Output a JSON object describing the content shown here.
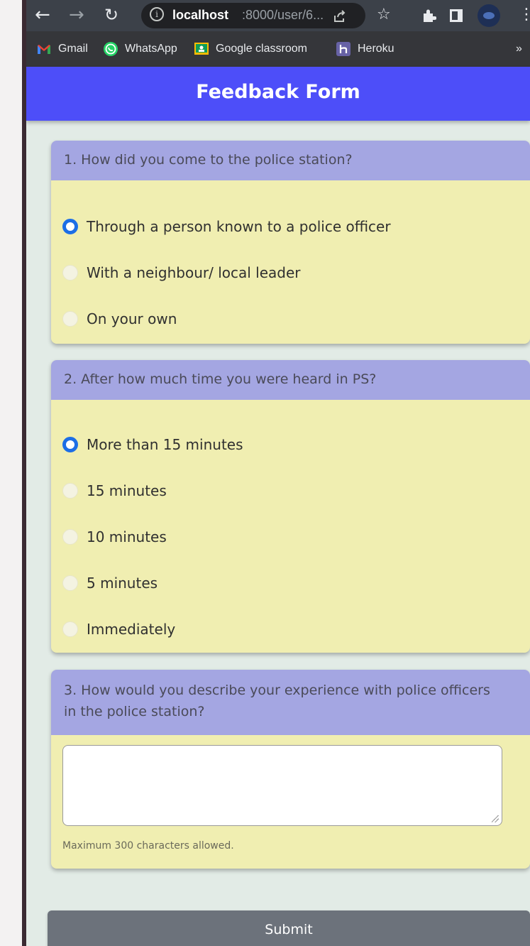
{
  "browser": {
    "url_host": "localhost",
    "url_path": ":8000/user/6...",
    "bookmarks": [
      {
        "label": "Gmail",
        "icon": "gmail-icon",
        "color": "#ea4335"
      },
      {
        "label": "WhatsApp",
        "icon": "whatsapp-icon",
        "color": "#25d366"
      },
      {
        "label": "Google classroom",
        "icon": "classroom-icon",
        "color": "#fbbc04"
      },
      {
        "label": "Heroku",
        "icon": "heroku-icon",
        "color": "#6762a6"
      }
    ],
    "more_bookmarks": "»"
  },
  "header": {
    "title": "Feedback Form",
    "color": "#4d4ef9"
  },
  "questions": [
    {
      "text": "1. How did you come to the police station?",
      "options": [
        {
          "label": "Through a person known to a police officer",
          "checked": true
        },
        {
          "label": "With a neighbour/ local leader",
          "checked": false
        },
        {
          "label": "On your own",
          "checked": false
        }
      ]
    },
    {
      "text": "2. After how much time you were heard in PS?",
      "options": [
        {
          "label": "More than 15 minutes",
          "checked": true
        },
        {
          "label": "15 minutes",
          "checked": false
        },
        {
          "label": "10 minutes",
          "checked": false
        },
        {
          "label": "5 minutes",
          "checked": false
        },
        {
          "label": "Immediately",
          "checked": false
        }
      ]
    },
    {
      "text_line1": "3. How would you describe your experience with police officers",
      "text_line2": "in the police station?",
      "answer": "",
      "hint": "Maximum 300 characters allowed."
    }
  ],
  "submit_label": "Submit",
  "colors": {
    "card": "#f0eeb1",
    "question_header": "#a4a6e2",
    "radio_selected": "#1c6ee6",
    "submit": "#6c727b"
  }
}
